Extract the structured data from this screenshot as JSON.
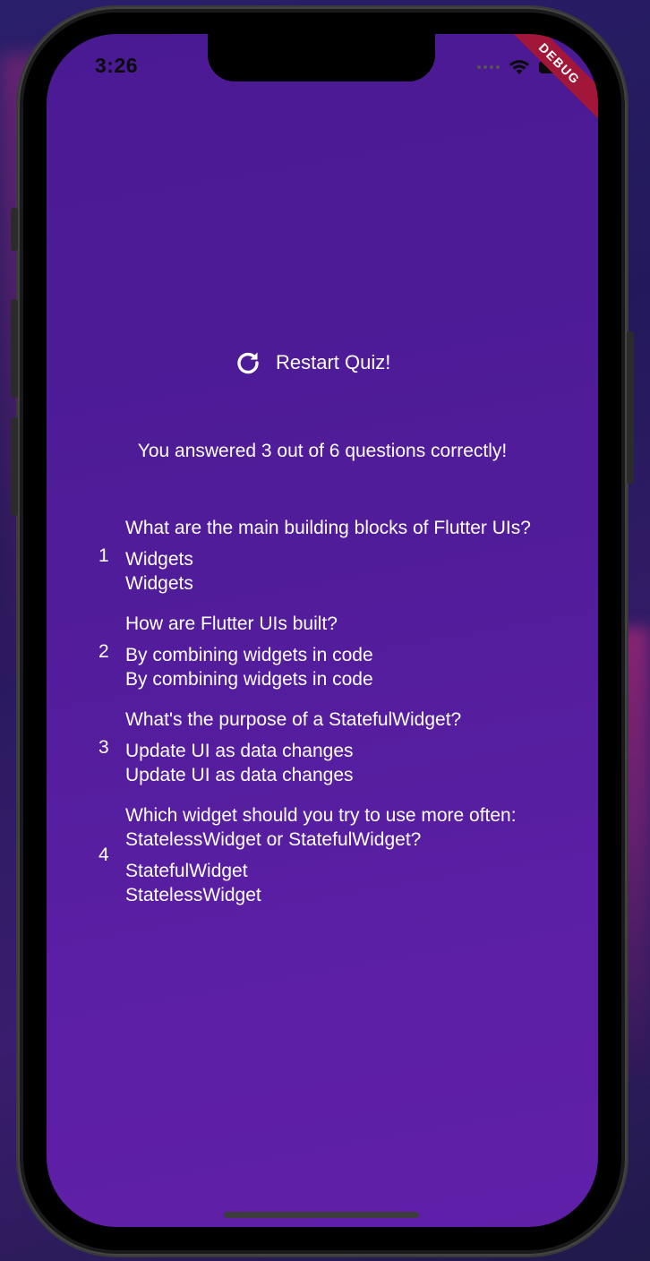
{
  "status_bar": {
    "time": "3:26",
    "debug_label": "DEBUG"
  },
  "restart_button": {
    "label": "Restart Quiz!",
    "icon": "refresh-icon"
  },
  "summary": {
    "text": "You answered 3 out of 6 questions correctly!"
  },
  "results": [
    {
      "index": "1",
      "question": "What are the main building blocks of Flutter UIs?",
      "user_answer": "Widgets",
      "correct_answer": "Widgets"
    },
    {
      "index": "2",
      "question": "How are Flutter UIs built?",
      "user_answer": "By combining widgets in code",
      "correct_answer": "By combining widgets in code"
    },
    {
      "index": "3",
      "question": "What's the purpose of a StatefulWidget?",
      "user_answer": "Update UI as data changes",
      "correct_answer": "Update UI as data changes"
    },
    {
      "index": "4",
      "question": "Which widget should you try to use more often: StatelessWidget or StatefulWidget?",
      "user_answer": "StatefulWidget",
      "correct_answer": "StatelessWidget"
    }
  ],
  "colors": {
    "screen_gradient_start": "#4a1a93",
    "screen_gradient_end": "#611fa8",
    "text": "#ffffff",
    "debug_banner": "#a2163a"
  }
}
